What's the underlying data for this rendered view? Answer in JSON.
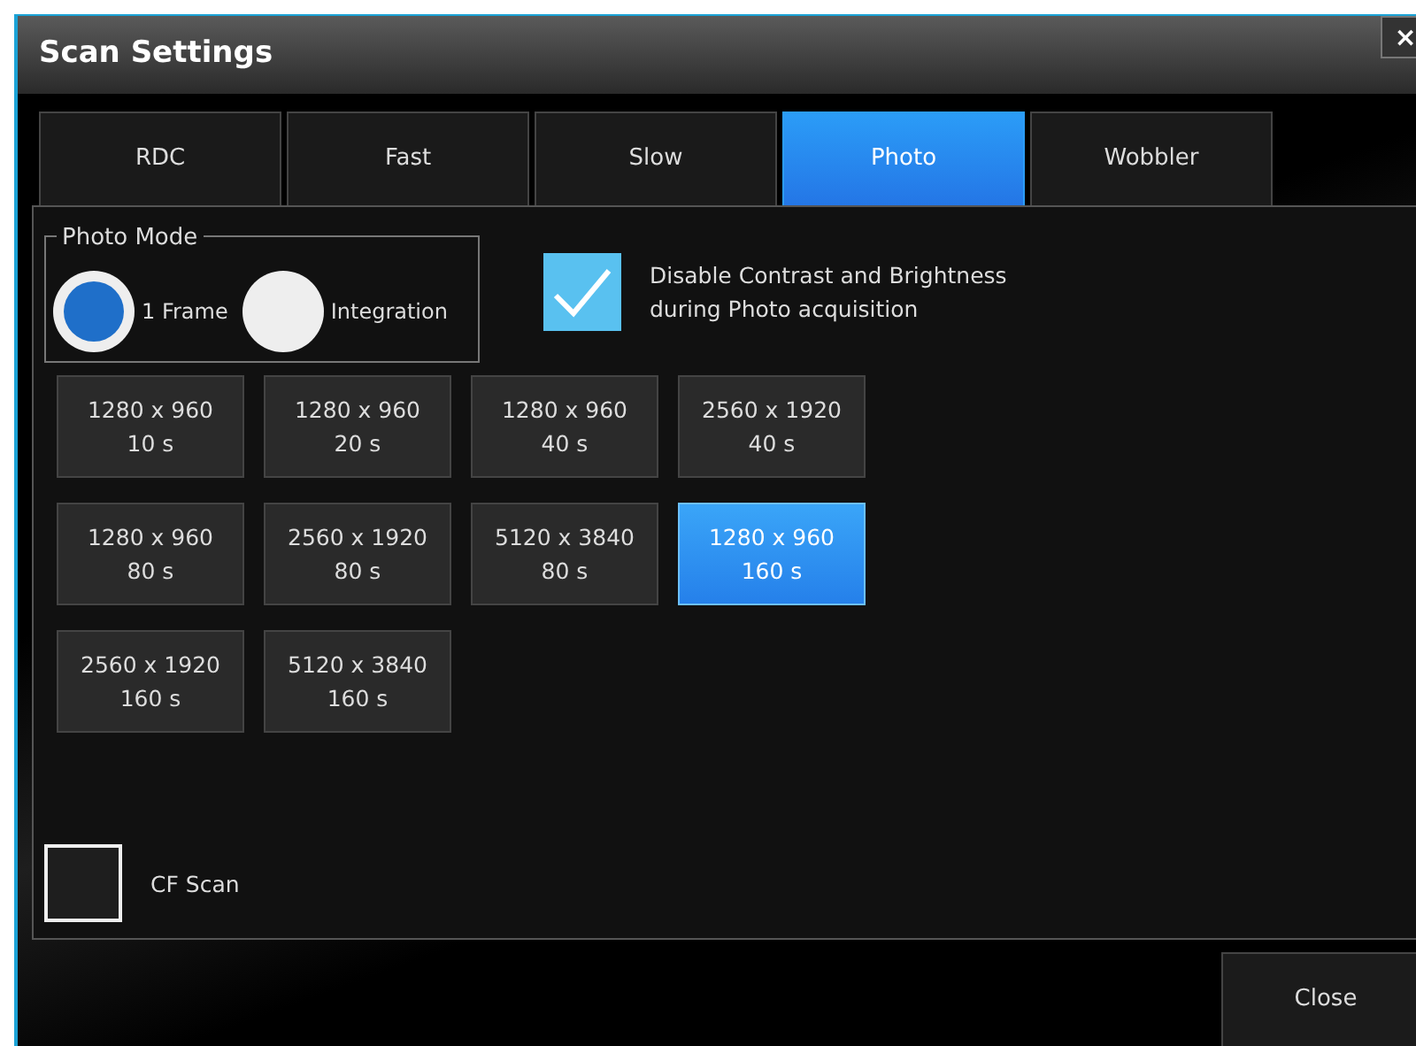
{
  "window": {
    "title": "Scan Settings",
    "close_glyph": "×"
  },
  "tabs": [
    {
      "label": "RDC",
      "selected": false
    },
    {
      "label": "Fast",
      "selected": false
    },
    {
      "label": "Slow",
      "selected": false
    },
    {
      "label": "Photo",
      "selected": true
    },
    {
      "label": "Wobbler",
      "selected": false
    }
  ],
  "photo_mode": {
    "label": "Photo Mode",
    "options": [
      {
        "label": "1 Frame",
        "selected": true
      },
      {
        "label": "Integration",
        "selected": false
      }
    ]
  },
  "disable_contrast": {
    "label": "Disable Contrast and Brightness\nduring Photo acquisition",
    "checked": true
  },
  "presets": [
    {
      "resolution": "1280 x 960",
      "time": "10 s",
      "selected": false
    },
    {
      "resolution": "1280 x 960",
      "time": "20 s",
      "selected": false
    },
    {
      "resolution": "1280 x 960",
      "time": "40 s",
      "selected": false
    },
    {
      "resolution": "2560 x 1920",
      "time": "40 s",
      "selected": false
    },
    {
      "resolution": "1280 x 960",
      "time": "80 s",
      "selected": false
    },
    {
      "resolution": "2560 x 1920",
      "time": "80 s",
      "selected": false
    },
    {
      "resolution": "5120 x 3840",
      "time": "80 s",
      "selected": false
    },
    {
      "resolution": "1280 x 960",
      "time": "160 s",
      "selected": true
    },
    {
      "resolution": "2560 x 1920",
      "time": "160 s",
      "selected": false
    },
    {
      "resolution": "5120 x 3840",
      "time": "160 s",
      "selected": false
    }
  ],
  "cf_scan": {
    "label": "CF Scan",
    "checked": false
  },
  "buttons": [
    "Close"
  ]
}
